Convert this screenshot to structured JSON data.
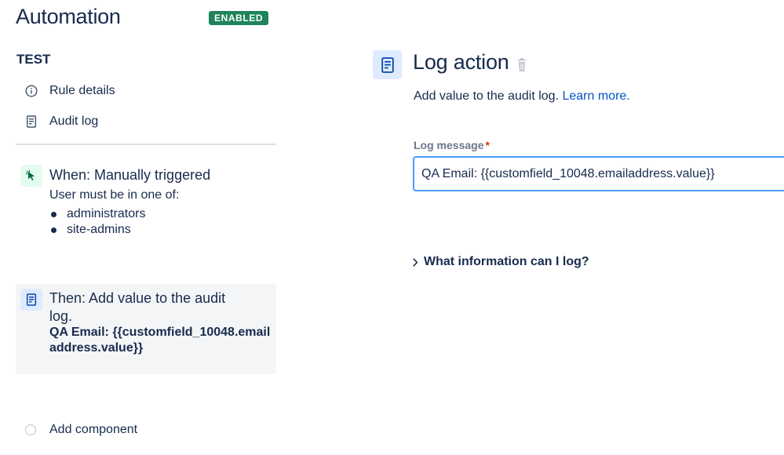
{
  "header": {
    "title": "Automation",
    "status_badge": "ENABLED"
  },
  "sidebar": {
    "rule_name": "TEST",
    "nav": [
      {
        "label": "Rule details",
        "icon": "info-icon"
      },
      {
        "label": "Audit log",
        "icon": "document-icon"
      }
    ],
    "trigger": {
      "title": "When: Manually triggered",
      "subtitle": "User must be in one of:",
      "groups": [
        "administrators",
        "site-admins"
      ],
      "icon": "cursor-click-icon",
      "accent": "#e3fcef"
    },
    "action": {
      "title": "Then: Add value to the audit log.",
      "detail": "QA Email: {{customfield_10048.emailaddress.value}}",
      "icon": "document-icon",
      "accent": "#deebff"
    },
    "add_component": "Add component"
  },
  "panel": {
    "title": "Log action",
    "description": "Add value to the audit log.",
    "learn_more": "Learn more.",
    "field_label": "Log message",
    "required_marker": "*",
    "field_value": "QA Email: {{customfield_10048.emailaddress.value}}",
    "expander": "What information can I log?"
  },
  "colors": {
    "text": "#172b4d",
    "link": "#0052cc",
    "badge": "#1f845a",
    "focus_border": "#4c9aff",
    "required": "#de350b"
  }
}
